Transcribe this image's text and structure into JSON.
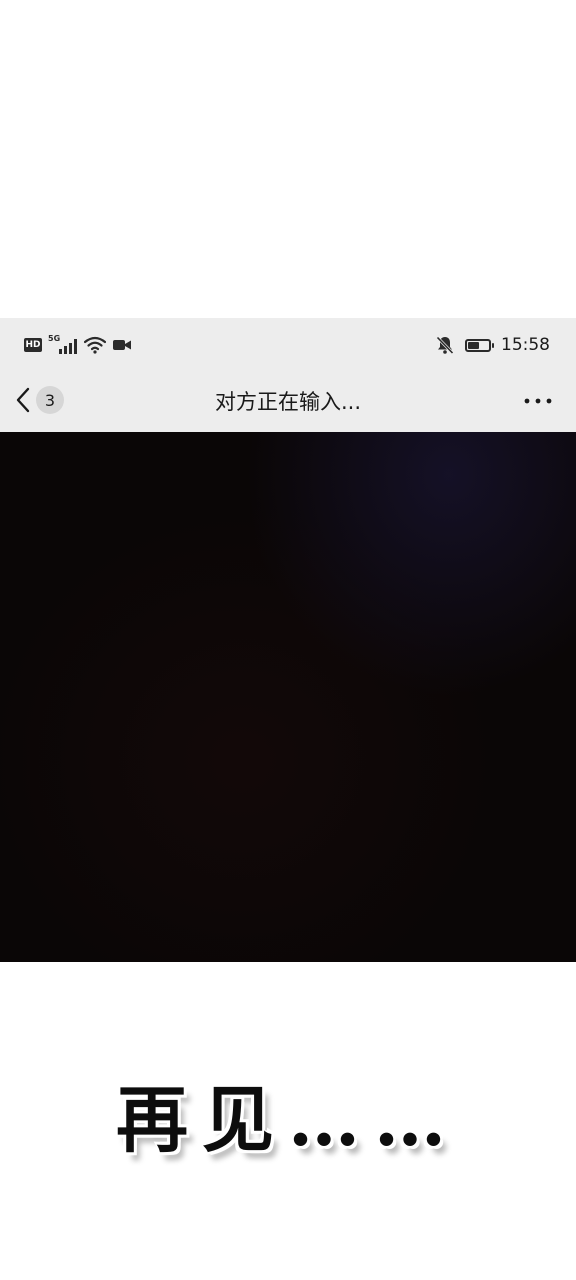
{
  "status_bar": {
    "hd": "HD",
    "network": "5G",
    "time": "15:58",
    "battery_level_percent": 60,
    "icons": [
      "hd-icon",
      "signal-5g-icon",
      "wifi-icon",
      "video-call-icon",
      "bell-muted-icon",
      "battery-icon"
    ]
  },
  "chat_header": {
    "unread_count": "3",
    "title": "对方正在输入...",
    "icons": [
      "chevron-left-icon",
      "more-dots-icon"
    ]
  },
  "caption": {
    "text": "再见……"
  },
  "colors": {
    "header_bg": "#ededed",
    "photo_bg": "#0a0606",
    "page_bg": "#ffffff",
    "text": "#1a1a1a"
  }
}
